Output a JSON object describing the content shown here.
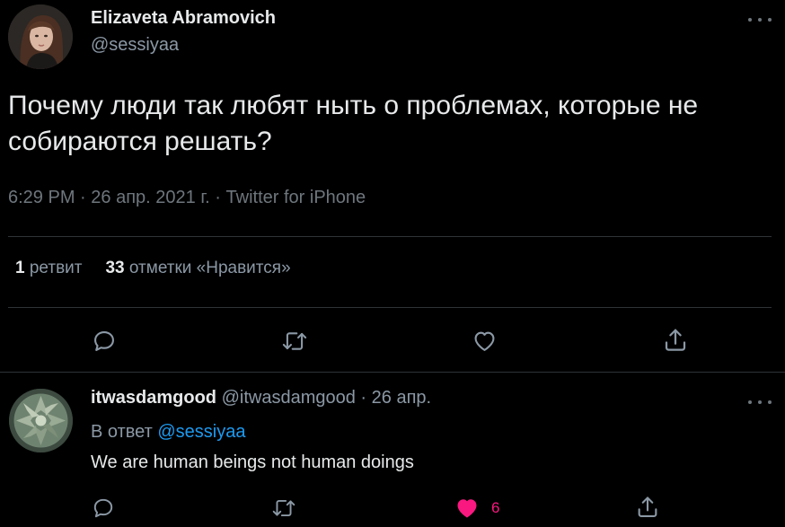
{
  "tweet": {
    "author_name": "Elizaveta Abramovich",
    "author_handle": "@sessiyaa",
    "text": "Почему люди так любят ныть о проблемах, которые не собираются решать?",
    "time": "6:29 PM",
    "date": "26 апр. 2021 г.",
    "source": "Twitter for iPhone",
    "separator": "·",
    "retweets_count": "1",
    "retweets_label": "ретвит",
    "likes_count": "33",
    "likes_label": "отметки «Нравится»"
  },
  "reply": {
    "author_name": "itwasdamgood",
    "author_handle": "@itwasdamgood",
    "separator": "·",
    "date": "26 апр.",
    "reply_to_label": "В ответ",
    "reply_to_handle": "@sessiyaa",
    "text": "We are human beings not human doings",
    "like_count": "6"
  },
  "icons": {
    "more": "more-horizontal-icon",
    "reply": "reply-bubble-icon",
    "retweet": "retweet-icon",
    "like": "heart-icon",
    "share": "share-icon"
  },
  "colors": {
    "background": "#000000",
    "text_primary": "#e7e9ea",
    "text_secondary": "#8b98a5",
    "link": "#1d9bf0",
    "like_active": "#f91880",
    "divider": "#2f3336"
  }
}
